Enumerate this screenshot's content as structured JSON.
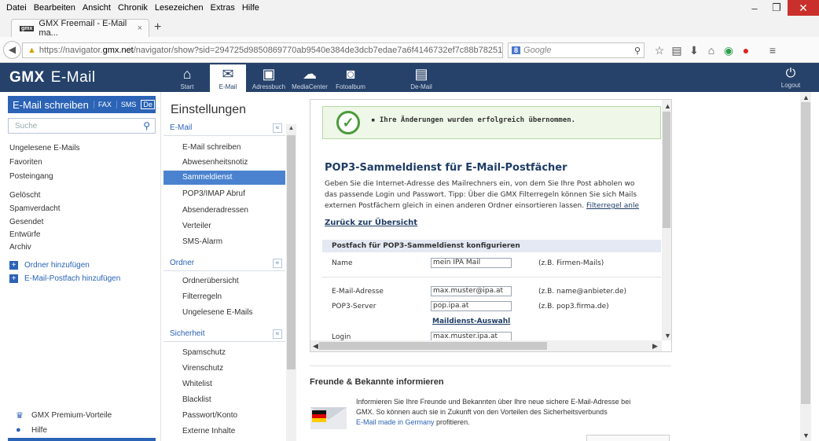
{
  "browser": {
    "menu": [
      "Datei",
      "Bearbeiten",
      "Ansicht",
      "Chronik",
      "Lesezeichen",
      "Extras",
      "Hilfe"
    ],
    "tab_title": "GMX Freemail - E-Mail ma...",
    "tab_favicon": "gmx",
    "tab_close": "×",
    "new_tab": "+",
    "url_prefix": "https://navigator.",
    "url_host": "gmx.net",
    "url_rest": "/navigator/show?sid=294725d9850869770ab9540e384de3dcb7edae7a6f4146732ef7c88b78251af0762",
    "search_placeholder": "Google",
    "search_engine": "8"
  },
  "gmx": {
    "logo": "GMX",
    "product": "E-Mail",
    "nav": [
      {
        "label": "Start",
        "icon": "home-icon",
        "glyph": "⌂"
      },
      {
        "label": "E-Mail",
        "icon": "envelope-icon",
        "glyph": "✉"
      },
      {
        "label": "Adressbuch",
        "icon": "addressbook-icon",
        "glyph": "▣"
      },
      {
        "label": "MediaCenter",
        "icon": "cloud-icon",
        "glyph": "☁"
      },
      {
        "label": "Fotoalbum",
        "icon": "camera-icon",
        "glyph": "◙"
      },
      {
        "label": "De-Mail",
        "icon": "demail-icon",
        "glyph": "▤"
      }
    ],
    "logout": "Logout"
  },
  "sidebar": {
    "compose": "E-Mail schreiben",
    "fax": "FAX",
    "sms": "SMS",
    "de": "De",
    "search_placeholder": "Suche",
    "folders": [
      "Ungelesene E-Mails",
      "Favoriten",
      "Posteingang",
      "Gelöscht",
      "Spamverdacht",
      "Gesendet",
      "Entwürfe",
      "Archiv"
    ],
    "add_folder": "Ordner hinzufügen",
    "add_mailbox": "E-Mail-Postfach hinzufügen",
    "premium": "GMX Premium-Vorteile",
    "help": "Hilfe"
  },
  "settings": {
    "title": "Einstellungen",
    "email_section": "E-Mail",
    "email_items": [
      "E-Mail schreiben",
      "Abwesenheitsnotiz",
      "Sammeldienst",
      "POP3/IMAP Abruf",
      "Absenderadressen",
      "Verteiler",
      "SMS-Alarm"
    ],
    "folder_section": "Ordner",
    "folder_items": [
      "Ordnerübersicht",
      "Filterregeln",
      "Ungelesene E-Mails"
    ],
    "security_section": "Sicherheit",
    "security_items": [
      "Spamschutz",
      "Virenschutz",
      "Whitelist",
      "Blacklist",
      "Passwort/Konto",
      "Externe Inhalte"
    ]
  },
  "content": {
    "success": "▪ Ihre Änderungen wurden erfolgreich übernommen.",
    "title": "POP3-Sammeldienst für E-Mail-Postfächer",
    "desc1": "Geben Sie die Internet-Adresse des Mailrechners ein, von dem Sie Ihre Post abholen wo",
    "desc2": "das passende Login und Passwort. Tipp: Über die GMX Filterregeln können Sie sich Mails",
    "desc3": "externen Postfächern gleich in einen anderen Ordner einsortieren lassen.",
    "desc3_link": "Filterregel anle",
    "back_link": "Zurück zur Übersicht",
    "form_header": "Postfach für POP3-Sammeldienst konfigurieren",
    "name_label": "Name",
    "name_value": "mein IPA Mail",
    "name_hint": "(z.B. Firmen-Mails)",
    "email_label": "E-Mail-Adresse",
    "email_value": "max.muster@ipa.at",
    "email_hint": "(z.B. name@anbieter.de)",
    "server_label": "POP3-Server",
    "server_value": "pop.ipa.at",
    "server_hint": "(z.B. pop3.firma.de)",
    "maildienst_link": "Maildienst-Auswahl",
    "login_label": "Login",
    "login_value": "max.muster.ipa.at"
  },
  "friends": {
    "title": "Freunde & Bekannte informieren",
    "text1": "Informieren Sie Ihre Freunde und Bekannten über Ihre neue sichere E-Mail-Adresse bei",
    "text2": "GMX. So können auch sie in Zukunft von den Vorteilen des Sicherheitsverbunds",
    "text3_link": "E-Mail made in Germany",
    "text3_rest": " profitieren."
  },
  "colors": {
    "header": "#26426a",
    "accent": "#2b63b6",
    "active": "#4a82cf",
    "success": "#4b9b3a"
  }
}
